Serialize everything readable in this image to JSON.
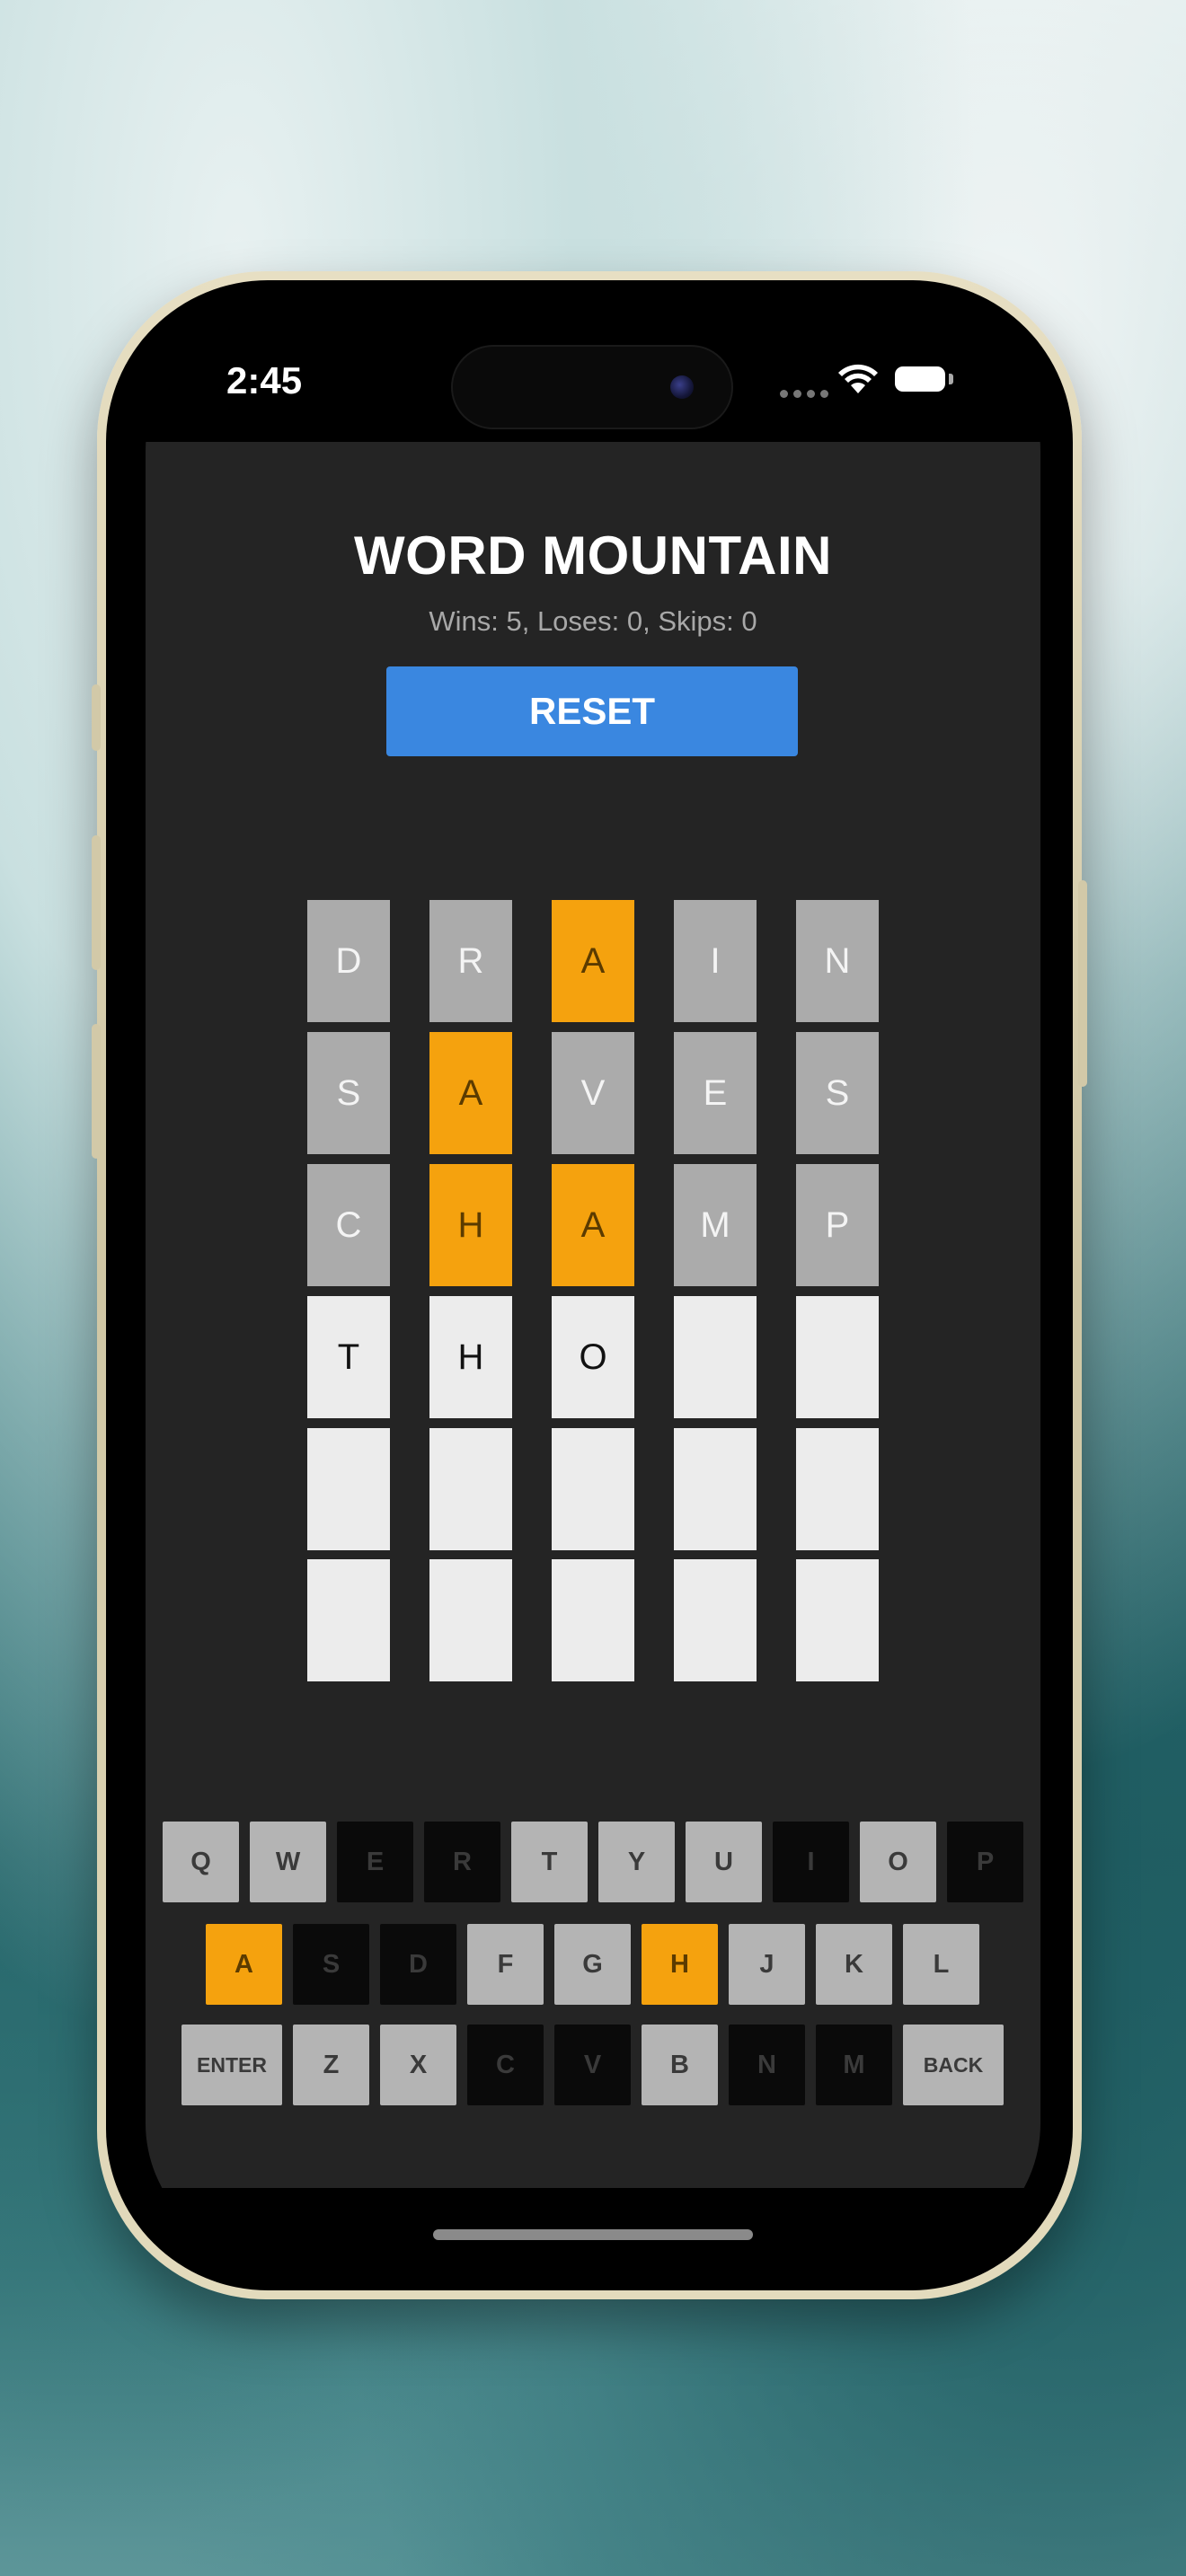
{
  "status_bar": {
    "time": "2:45"
  },
  "app": {
    "title": "WORD MOUNTAIN",
    "stats": "Wins: 5, Loses: 0, Skips: 0",
    "reset_label": "RESET"
  },
  "board": {
    "rows": [
      [
        {
          "letter": "D",
          "state": "gray"
        },
        {
          "letter": "R",
          "state": "gray"
        },
        {
          "letter": "A",
          "state": "orange"
        },
        {
          "letter": "I",
          "state": "gray"
        },
        {
          "letter": "N",
          "state": "gray"
        }
      ],
      [
        {
          "letter": "S",
          "state": "gray"
        },
        {
          "letter": "A",
          "state": "orange"
        },
        {
          "letter": "V",
          "state": "gray"
        },
        {
          "letter": "E",
          "state": "gray"
        },
        {
          "letter": "S",
          "state": "gray"
        }
      ],
      [
        {
          "letter": "C",
          "state": "gray"
        },
        {
          "letter": "H",
          "state": "orange"
        },
        {
          "letter": "A",
          "state": "orange"
        },
        {
          "letter": "M",
          "state": "gray"
        },
        {
          "letter": "P",
          "state": "gray"
        }
      ],
      [
        {
          "letter": "T",
          "state": "white"
        },
        {
          "letter": "H",
          "state": "white"
        },
        {
          "letter": "O",
          "state": "white"
        },
        {
          "letter": "",
          "state": "white"
        },
        {
          "letter": "",
          "state": "white"
        }
      ],
      [
        {
          "letter": "",
          "state": "white"
        },
        {
          "letter": "",
          "state": "white"
        },
        {
          "letter": "",
          "state": "white"
        },
        {
          "letter": "",
          "state": "white"
        },
        {
          "letter": "",
          "state": "white"
        }
      ],
      [
        {
          "letter": "",
          "state": "white"
        },
        {
          "letter": "",
          "state": "white"
        },
        {
          "letter": "",
          "state": "white"
        },
        {
          "letter": "",
          "state": "white"
        },
        {
          "letter": "",
          "state": "white"
        }
      ]
    ]
  },
  "keyboard": {
    "rows": [
      [
        {
          "label": "Q",
          "state": "gray"
        },
        {
          "label": "W",
          "state": "gray"
        },
        {
          "label": "E",
          "state": "black"
        },
        {
          "label": "R",
          "state": "black"
        },
        {
          "label": "T",
          "state": "gray"
        },
        {
          "label": "Y",
          "state": "gray"
        },
        {
          "label": "U",
          "state": "gray"
        },
        {
          "label": "I",
          "state": "black"
        },
        {
          "label": "O",
          "state": "gray"
        },
        {
          "label": "P",
          "state": "black"
        }
      ],
      [
        {
          "label": "A",
          "state": "orange"
        },
        {
          "label": "S",
          "state": "black"
        },
        {
          "label": "D",
          "state": "black"
        },
        {
          "label": "F",
          "state": "gray"
        },
        {
          "label": "G",
          "state": "gray"
        },
        {
          "label": "H",
          "state": "orange"
        },
        {
          "label": "J",
          "state": "gray"
        },
        {
          "label": "K",
          "state": "gray"
        },
        {
          "label": "L",
          "state": "gray"
        }
      ],
      [
        {
          "label": "ENTER",
          "state": "gray"
        },
        {
          "label": "Z",
          "state": "gray"
        },
        {
          "label": "X",
          "state": "gray"
        },
        {
          "label": "C",
          "state": "black"
        },
        {
          "label": "V",
          "state": "black"
        },
        {
          "label": "B",
          "state": "gray"
        },
        {
          "label": "N",
          "state": "black"
        },
        {
          "label": "M",
          "state": "black"
        },
        {
          "label": "BACK",
          "state": "gray"
        }
      ]
    ]
  },
  "colors": {
    "accent_blue": "#3a87e0",
    "present_orange": "#f5a20e",
    "absent_gray": "#ababab",
    "empty_white": "#ececec",
    "unused_key_black": "#0a0a0a",
    "app_background": "#242424"
  }
}
